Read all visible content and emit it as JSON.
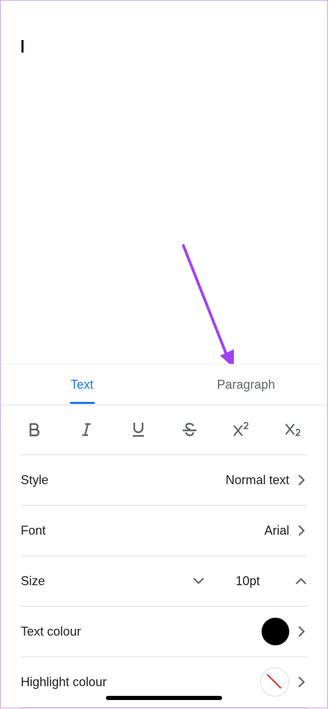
{
  "tabs": [
    {
      "label": "Text",
      "active": true
    },
    {
      "label": "Paragraph",
      "active": false
    }
  ],
  "format_buttons": [
    "bold-icon",
    "italic-icon",
    "underline-icon",
    "strikethrough-icon",
    "superscript-icon",
    "subscript-icon"
  ],
  "rows": {
    "style": {
      "label": "Style",
      "value": "Normal text"
    },
    "font": {
      "label": "Font",
      "value": "Arial"
    },
    "size": {
      "label": "Size",
      "value": "10pt"
    },
    "text_colour": {
      "label": "Text colour",
      "color": "#000000"
    },
    "highlight_colour": {
      "label": "Highlight colour",
      "color": "none"
    }
  },
  "colors": {
    "accent": "#1a73e8",
    "annotation_arrow": "#a142f4"
  }
}
